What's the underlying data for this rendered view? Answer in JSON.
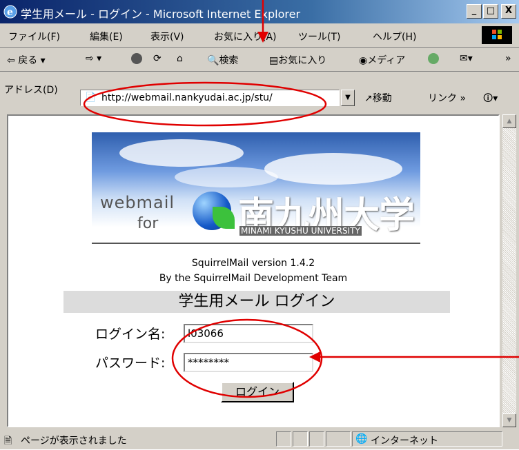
{
  "window": {
    "title": "学生用メール - ログイン - Microsoft Internet Explorer",
    "controls": {
      "minimize": "_",
      "maximize": "□",
      "close": "X"
    }
  },
  "menu": [
    "ファイル(F)",
    "編集(E)",
    "表示(V)",
    "お気に入り(A)",
    "ツール(T)",
    "ヘルプ(H)"
  ],
  "toolbar": {
    "back": "戻る",
    "search": "検索",
    "favorites": "お気に入り",
    "media": "メディア",
    "more": "»"
  },
  "address": {
    "label": "アドレス(D)",
    "url": "http://webmail.nankyudai.ac.jp/stu/",
    "go": "移動",
    "links": "リンク »"
  },
  "page": {
    "banner": {
      "webmail": "webmail",
      "for": "for",
      "university_jp": "南九州大学",
      "university_en": "MINAMI KYUSHU UNIVERSITY"
    },
    "version": "SquirrelMail version 1.4.2",
    "team": "By the SquirrelMail Development Team",
    "heading": "学生用メール ログイン",
    "login_label": "ログイン名:",
    "login_value": "l03066",
    "password_label": "パスワード:",
    "password_value": "********",
    "submit": "ログイン"
  },
  "status": {
    "message": "ページが表示されました",
    "zone": "インターネット"
  },
  "annotations": {
    "color": "#e00000"
  }
}
